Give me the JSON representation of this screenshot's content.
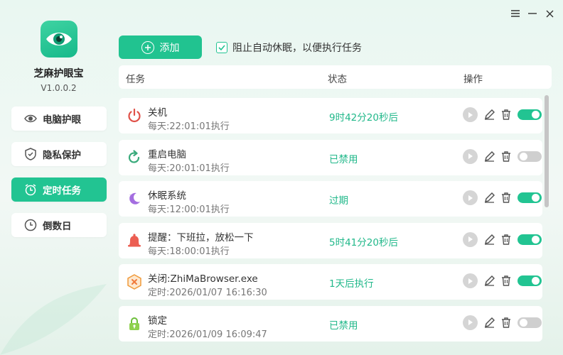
{
  "app": {
    "name": "芝麻护眼宝",
    "version": "V1.0.0.2"
  },
  "window": {
    "menu_icon": "menu-icon",
    "minimize_icon": "minimize-icon",
    "close_icon": "close-icon"
  },
  "nav": {
    "items": [
      {
        "label": "电脑护眼",
        "icon": "eye-icon",
        "active": false
      },
      {
        "label": "隐私保护",
        "icon": "shield-icon",
        "active": false
      },
      {
        "label": "定时任务",
        "icon": "alarm-clock-icon",
        "active": true
      },
      {
        "label": "倒数日",
        "icon": "clock-icon",
        "active": false
      }
    ]
  },
  "toolbar": {
    "add_label": "添加",
    "prevent_sleep_label": "阻止自动休眠，以便执行任务",
    "prevent_sleep_checked": true
  },
  "table": {
    "headers": {
      "task": "任务",
      "status": "状态",
      "action": "操作"
    },
    "rows": [
      {
        "title": "关机",
        "schedule": "每天:22:01:01执行",
        "status": "9时42分20秒后",
        "icon": "power-icon",
        "enabled": true
      },
      {
        "title": "重启电脑",
        "schedule": "每天:20:01:01执行",
        "status": "已禁用",
        "icon": "restart-icon",
        "enabled": false
      },
      {
        "title": "休眠系统",
        "schedule": "每天:12:00:01执行",
        "status": "过期",
        "icon": "moon-icon",
        "enabled": true
      },
      {
        "title": "提醒：下班拉，放松一下",
        "schedule": "每天:18:00:01执行",
        "status": "5时41分20秒后",
        "icon": "bell-icon",
        "enabled": true
      },
      {
        "title": "关闭:ZhiMaBrowser.exe",
        "schedule": "定时:2026/01/07 16:16:30",
        "status": "1天后执行",
        "icon": "close-app-icon",
        "enabled": true
      },
      {
        "title": "锁定",
        "schedule": "定时:2026/01/09 16:09:47",
        "status": "已禁用",
        "icon": "lock-icon",
        "enabled": false
      }
    ]
  },
  "colors": {
    "accent": "#22c492",
    "status_text": "#21b88a",
    "toggle_off": "#cfcfcf"
  }
}
